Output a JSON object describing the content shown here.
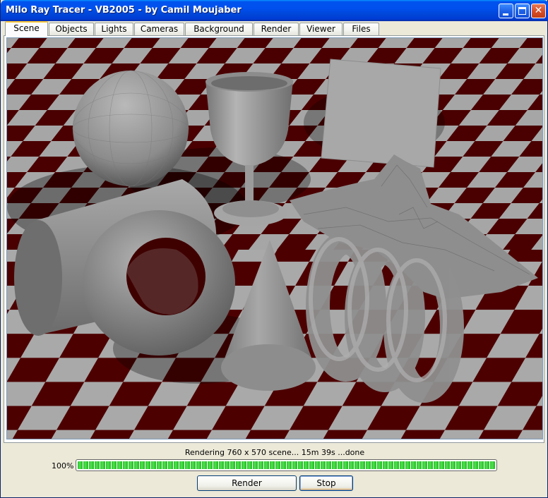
{
  "window": {
    "title": "Milo Ray Tracer - VB2005 - by Camil Moujaber",
    "controls": {
      "minimize_icon": "minimize-icon",
      "maximize_icon": "maximize-icon",
      "close_icon": "close-icon",
      "close_glyph": "✕"
    }
  },
  "tabs": [
    {
      "label": "Scene",
      "active": true
    },
    {
      "label": "Objects",
      "active": false
    },
    {
      "label": "Lights",
      "active": false
    },
    {
      "label": "Cameras",
      "active": false
    },
    {
      "label": "Background",
      "active": false
    },
    {
      "label": "Render",
      "active": false
    },
    {
      "label": "Viewer",
      "active": false
    },
    {
      "label": "Files",
      "active": false
    }
  ],
  "scene": {
    "floor_colors": {
      "light": "#a8a8a8",
      "dark": "#4a0000"
    },
    "object_color": "#9a9a9a"
  },
  "status": {
    "message": "Rendering 760 x 570 scene... 15m 39s ...done",
    "progress_label": "100%",
    "progress_value": 1.0,
    "progress_color": "#33cc33"
  },
  "buttons": {
    "render_label": "Render",
    "stop_label": "Stop"
  }
}
